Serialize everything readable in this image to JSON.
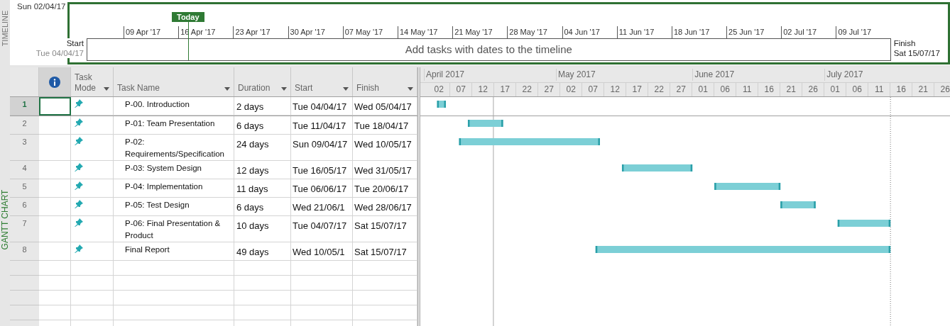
{
  "timeline": {
    "side_label": "TIMELINE",
    "range_start": "Sun 02/04/17",
    "today_label": "Today",
    "scale": [
      "09 Apr '17",
      "16 Apr '17",
      "23 Apr '17",
      "30 Apr '17",
      "07 May '17",
      "14 May '17",
      "21 May '17",
      "28 May '17",
      "04 Jun '17",
      "11 Jun '17",
      "18 Jun '17",
      "25 Jun '17",
      "02 Jul '17",
      "09 Jul '17"
    ],
    "start_label": "Start",
    "start_date": "Tue 04/04/17",
    "hint": "Add tasks with dates to the timeline",
    "finish_label": "Finish",
    "finish_date": "Sat 15/07/17"
  },
  "gantt": {
    "side_label": "GANTT CHART",
    "columns": [
      {
        "kind": "indicator"
      },
      {
        "kind": "text",
        "label": "Task Mode"
      },
      {
        "kind": "text",
        "label": "Task Name"
      },
      {
        "kind": "text",
        "label": "Duration"
      },
      {
        "kind": "text",
        "label": "Start"
      },
      {
        "kind": "text",
        "label": "Finish"
      }
    ],
    "rows": [
      {
        "id": "1",
        "selected": true,
        "kind": "manual",
        "name": "P-00. Introduction",
        "duration": "2 days",
        "start": "Tue 04/04/17",
        "finish": "Wed 05/04/17"
      },
      {
        "id": "2",
        "selected": false,
        "kind": "manual",
        "name": "P-01: Team Presentation",
        "duration": "6 days",
        "start": "Tue 11/04/17",
        "finish": "Tue 18/04/17"
      },
      {
        "id": "3",
        "selected": false,
        "kind": "manual",
        "name": "P-02: Requirements/Specification",
        "duration": "24 days",
        "start": "Sun 09/04/17",
        "finish": "Wed 10/05/17"
      },
      {
        "id": "4",
        "selected": false,
        "kind": "manual",
        "name": "P-03: System Design",
        "duration": "12 days",
        "start": "Tue 16/05/17",
        "finish": "Wed 31/05/17"
      },
      {
        "id": "5",
        "selected": false,
        "kind": "manual",
        "name": "P-04: Implementation",
        "duration": "11 days",
        "start": "Tue 06/06/17",
        "finish": "Tue 20/06/17"
      },
      {
        "id": "6",
        "selected": false,
        "kind": "manual",
        "name": "P-05: Test Design",
        "duration": "6 days",
        "start": "Wed 21/06/1",
        "finish": "Wed 28/06/17"
      },
      {
        "id": "7",
        "selected": false,
        "kind": "manual",
        "name": "P-06: Final Presentation & Product",
        "duration": "10 days",
        "start": "Tue 04/07/17",
        "finish": "Sat 15/07/17"
      },
      {
        "id": "8",
        "selected": false,
        "kind": "manual",
        "name": "Final Report",
        "duration": "49 days",
        "start": "Wed 10/05/1",
        "finish": "Sat 15/07/17"
      }
    ],
    "timescale": [
      {
        "month": "April 2017",
        "days": [
          "02",
          "07",
          "12",
          "17",
          "22",
          "27"
        ]
      },
      {
        "month": "May 2017",
        "days": [
          "02",
          "07",
          "12",
          "17",
          "22",
          "27"
        ]
      },
      {
        "month": "June 2017",
        "days": [
          "01",
          "06",
          "11",
          "16",
          "21",
          "26"
        ]
      },
      {
        "month": "July 2017",
        "days": [
          "01",
          "06",
          "11",
          "16",
          "21",
          "26"
        ]
      }
    ]
  }
}
